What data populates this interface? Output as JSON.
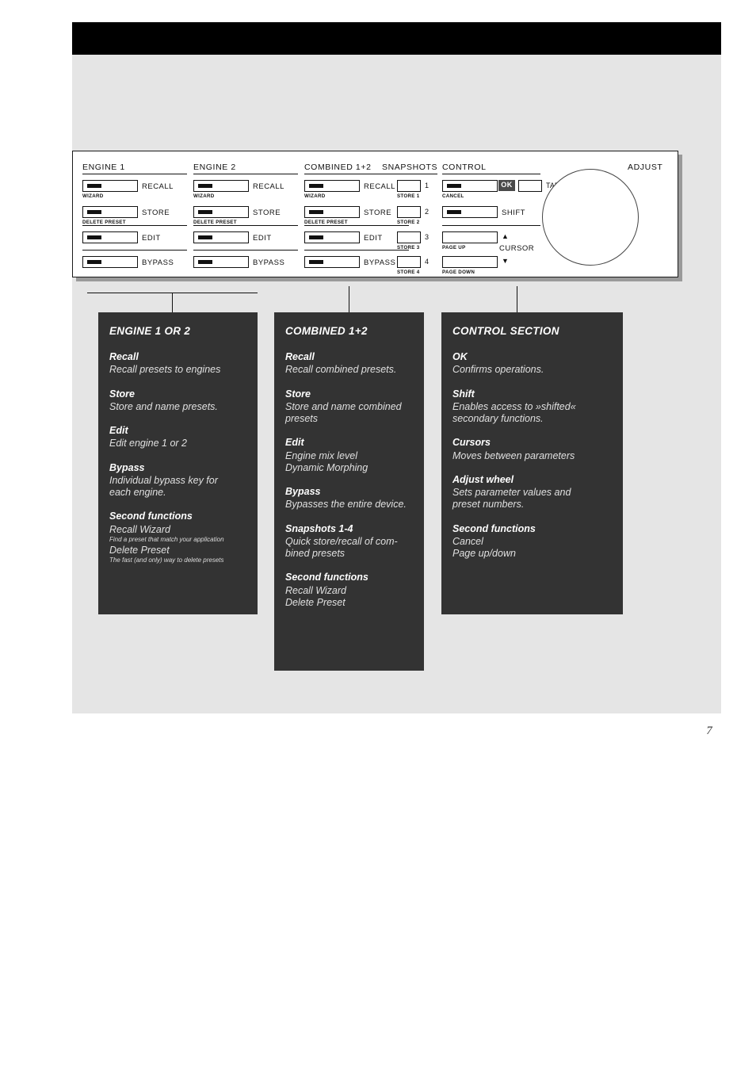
{
  "page": {
    "number": "7"
  },
  "device_panel": {
    "sections": [
      {
        "title": "ENGINE  1",
        "keys": [
          {
            "label": "RECALL",
            "sub": "WIZARD",
            "led": true
          },
          {
            "label": "STORE",
            "sub": "DELETE PRESET",
            "led": true
          },
          {
            "label": "EDIT",
            "sub": "",
            "led": true
          },
          {
            "label": "BYPASS",
            "sub": "",
            "led": true
          }
        ]
      },
      {
        "title": "ENGINE  2",
        "keys": [
          {
            "label": "RECALL",
            "sub": "WIZARD",
            "led": true
          },
          {
            "label": "STORE",
            "sub": "DELETE PRESET",
            "led": true
          },
          {
            "label": "EDIT",
            "sub": "",
            "led": true
          },
          {
            "label": "BYPASS",
            "sub": "",
            "led": true
          }
        ]
      },
      {
        "title": "COMBINED  1+2",
        "keys": [
          {
            "label": "RECALL",
            "sub": "WIZARD",
            "led": true
          },
          {
            "label": "STORE",
            "sub": "DELETE PRESET",
            "led": true
          },
          {
            "label": "EDIT",
            "sub": "",
            "led": true
          },
          {
            "label": "BYPASS",
            "sub": "",
            "led": true
          }
        ]
      },
      {
        "title": "SNAPSHOTS",
        "keys": [
          {
            "label": "1",
            "sub": "STORE 1",
            "led": false
          },
          {
            "label": "2",
            "sub": "STORE 2",
            "led": false
          },
          {
            "label": "3",
            "sub": "STORE 3",
            "led": false
          },
          {
            "label": "4",
            "sub": "STORE 4",
            "led": false
          }
        ]
      },
      {
        "title": "CONTROL",
        "keys": [
          {
            "label": "OK",
            "sub": "CANCEL",
            "led": true
          },
          {
            "label": "TAP",
            "sub": "",
            "led": false
          },
          {
            "label": "SHIFT",
            "sub": "",
            "led": true
          },
          {
            "label": "▲",
            "sub": "PAGE UP",
            "led": false
          },
          {
            "label": "▼",
            "sub": "PAGE DOWN",
            "led": false
          }
        ],
        "cursor_label": "CURSOR"
      },
      {
        "title": "ADJUST",
        "keys": []
      }
    ]
  },
  "boxes": [
    {
      "title": "ENGINE 1 OR 2",
      "groups": [
        {
          "heading": "Recall",
          "lines": [
            "Recall presets to engines"
          ],
          "small": []
        },
        {
          "heading": "Store",
          "lines": [
            "Store and name presets."
          ],
          "small": []
        },
        {
          "heading": "Edit",
          "lines": [
            "Edit engine 1 or 2"
          ],
          "small": []
        },
        {
          "heading": "Bypass",
          "lines": [
            "Individual bypass key for",
            "each engine."
          ],
          "small": []
        },
        {
          "heading": "Second functions",
          "items": [
            {
              "line": "Recall Wizard",
              "caption": "Find a preset that match your application"
            },
            {
              "line": "Delete Preset",
              "caption": "The fast (and only) way to delete presets"
            }
          ]
        }
      ]
    },
    {
      "title": "COMBINED 1+2",
      "groups": [
        {
          "heading": "Recall",
          "lines": [
            "Recall combined presets."
          ],
          "small": []
        },
        {
          "heading": "Store",
          "lines": [
            "Store and name combined",
            "presets"
          ],
          "small": []
        },
        {
          "heading": "Edit",
          "lines": [
            "Engine mix level",
            "Dynamic Morphing"
          ],
          "small": []
        },
        {
          "heading": "Bypass",
          "lines": [
            "Bypasses the entire device."
          ],
          "small": []
        },
        {
          "heading": "Snapshots 1-4",
          "lines": [
            "Quick store/recall of com-",
            "bined presets"
          ],
          "small": []
        },
        {
          "heading": "Second functions",
          "lines": [
            "Recall Wizard",
            "Delete Preset"
          ],
          "small": []
        }
      ]
    },
    {
      "title": "CONTROL SECTION",
      "groups": [
        {
          "heading": "OK",
          "lines": [
            "Confirms operations."
          ],
          "small": []
        },
        {
          "heading": "Shift",
          "lines": [
            "Enables access to »shifted«",
            "secondary functions."
          ],
          "small": []
        },
        {
          "heading": "Cursors",
          "lines": [
            "Moves between parameters"
          ],
          "small": []
        },
        {
          "heading": "Adjust wheel",
          "lines": [
            "Sets parameter values and",
            "preset numbers."
          ],
          "small": []
        },
        {
          "heading": "Second functions",
          "lines": [
            "Cancel",
            "Page up/down"
          ],
          "small": []
        }
      ]
    }
  ]
}
